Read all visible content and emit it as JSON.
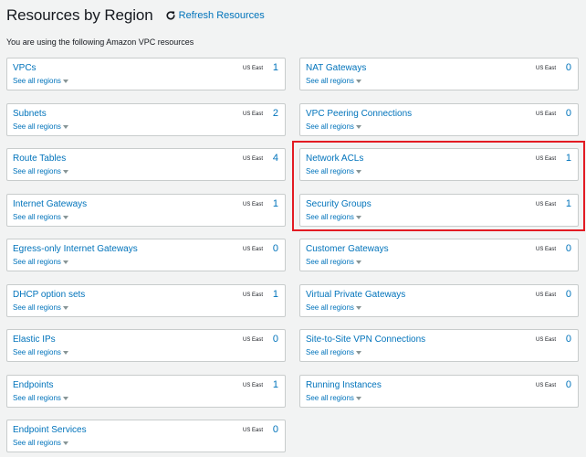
{
  "header": {
    "title": "Resources by Region",
    "refresh_label": "Refresh Resources"
  },
  "subtitle": "You are using the following Amazon VPC resources",
  "see_all_label": "See all regions",
  "left_cards": [
    {
      "name": "VPCs",
      "region": "US East",
      "count": "1"
    },
    {
      "name": "Subnets",
      "region": "US East",
      "count": "2"
    },
    {
      "name": "Route Tables",
      "region": "US East",
      "count": "4"
    },
    {
      "name": "Internet Gateways",
      "region": "US East",
      "count": "1"
    },
    {
      "name": "Egress-only Internet Gateways",
      "region": "US East",
      "count": "0"
    },
    {
      "name": "DHCP option sets",
      "region": "US East",
      "count": "1"
    },
    {
      "name": "Elastic IPs",
      "region": "US East",
      "count": "0"
    },
    {
      "name": "Endpoints",
      "region": "US East",
      "count": "1"
    },
    {
      "name": "Endpoint Services",
      "region": "US East",
      "count": "0"
    }
  ],
  "right_cards": [
    {
      "name": "NAT Gateways",
      "region": "US East",
      "count": "0"
    },
    {
      "name": "VPC Peering Connections",
      "region": "US East",
      "count": "0"
    },
    {
      "name": "Network ACLs",
      "region": "US East",
      "count": "1"
    },
    {
      "name": "Security Groups",
      "region": "US East",
      "count": "1"
    },
    {
      "name": "Customer Gateways",
      "region": "US East",
      "count": "0"
    },
    {
      "name": "Virtual Private Gateways",
      "region": "US East",
      "count": "0"
    },
    {
      "name": "Site-to-Site VPN Connections",
      "region": "US East",
      "count": "0"
    },
    {
      "name": "Running Instances",
      "region": "US East",
      "count": "0"
    }
  ],
  "colors": {
    "link": "#0073bb",
    "highlight": "#e31b23",
    "background": "#f2f3f3"
  },
  "icons": {
    "refresh": "refresh-icon",
    "dropdown": "caret-down-icon"
  }
}
